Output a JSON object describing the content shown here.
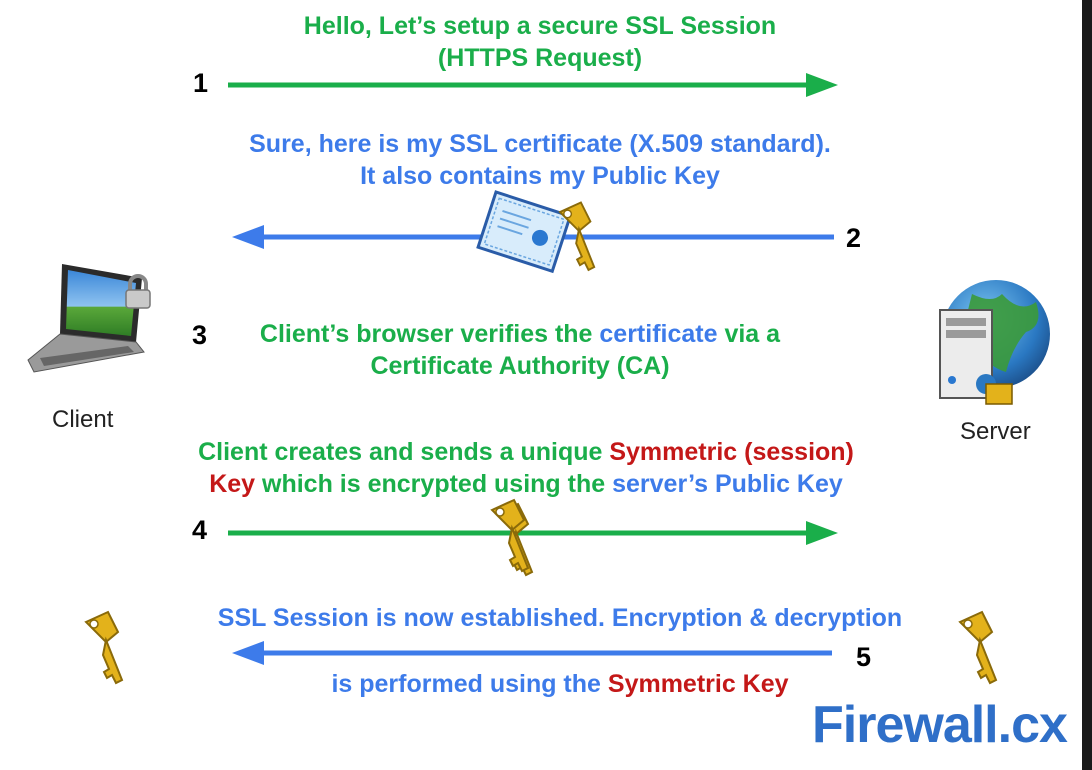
{
  "steps": [
    {
      "number": "1",
      "lines": [
        [
          {
            "text": "Hello, Let’s setup a secure SSL Session",
            "color": "green"
          }
        ],
        [
          {
            "text": "(HTTPS Request)",
            "color": "green"
          }
        ]
      ]
    },
    {
      "number": "2",
      "lines": [
        [
          {
            "text": "Sure, here is my SSL certificate (X.509 standard).",
            "color": "blue"
          }
        ],
        [
          {
            "text": "It also contains my Public Key",
            "color": "blue"
          }
        ]
      ]
    },
    {
      "number": "3",
      "lines": [
        [
          {
            "text": "Client’s browser verifies the ",
            "color": "green"
          },
          {
            "text": "certificate",
            "color": "blue"
          },
          {
            "text": " via a",
            "color": "green"
          }
        ],
        [
          {
            "text": "Certificate Authority (CA)",
            "color": "green"
          }
        ]
      ]
    },
    {
      "number": "4",
      "lines": [
        [
          {
            "text": "Client creates and sends a unique ",
            "color": "green"
          },
          {
            "text": "Symmetric (session)",
            "color": "red"
          }
        ],
        [
          {
            "text": "Key",
            "color": "red"
          },
          {
            "text": " which is encrypted using the ",
            "color": "green"
          },
          {
            "text": "server’s Public Key",
            "color": "blue"
          }
        ]
      ]
    },
    {
      "number": "5",
      "lines": [
        [
          {
            "text": "SSL Session is now established. Encryption & decryption",
            "color": "blue"
          }
        ],
        [
          {
            "text": "is performed using the ",
            "color": "blue"
          },
          {
            "text": "Symmetric Key",
            "color": "red"
          }
        ]
      ]
    }
  ],
  "client_label": "Client",
  "server_label": "Server",
  "logo": {
    "main": "Firewall.",
    "suffix": "cx"
  },
  "colors": {
    "green": "#1aae4a",
    "blue": "#3d7bea",
    "red": "#c41818"
  },
  "icons": [
    "laptop-icon",
    "padlock-icon",
    "server-globe-icon",
    "certificate-icon",
    "key-icon"
  ]
}
